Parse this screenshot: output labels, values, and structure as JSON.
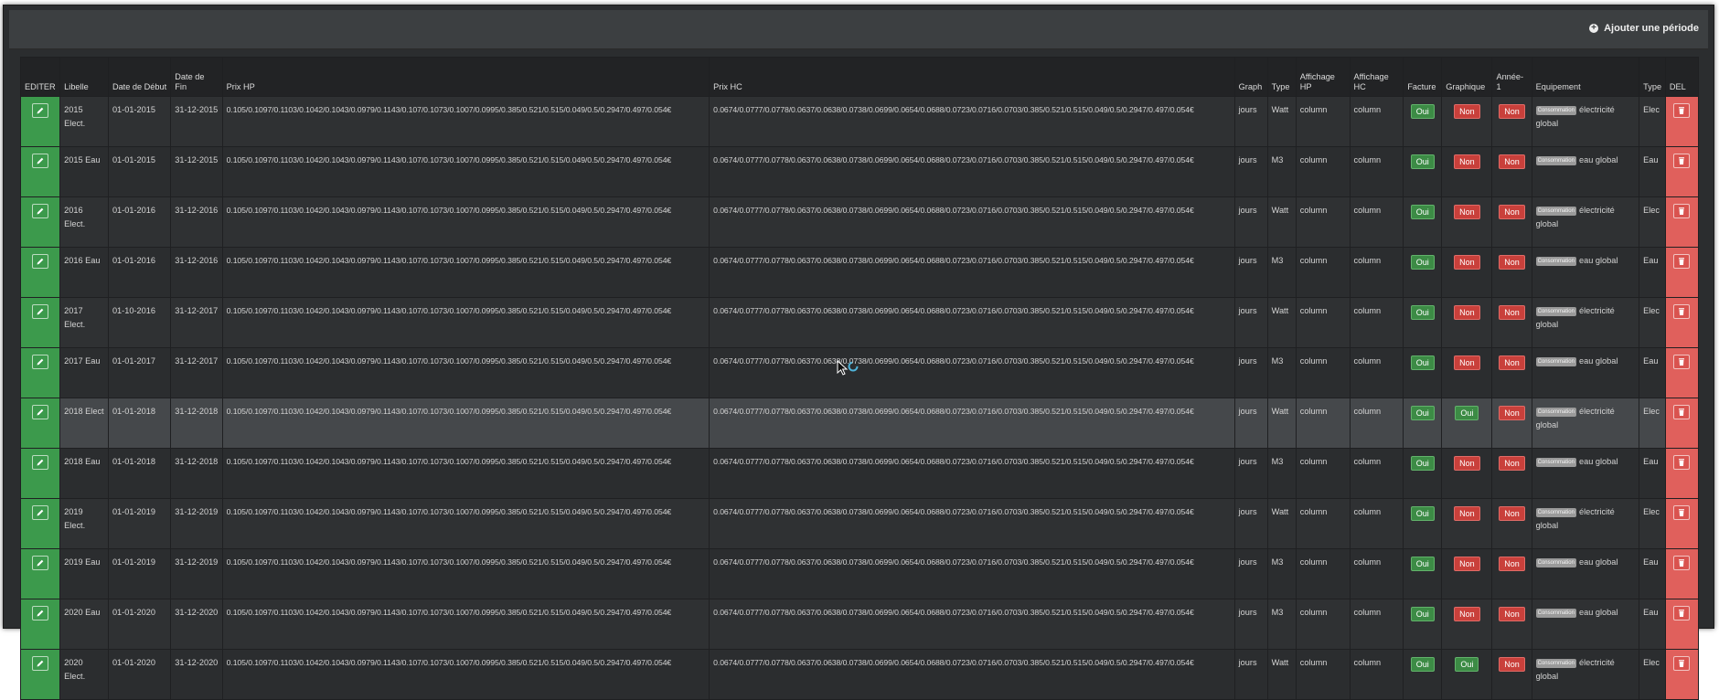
{
  "toolbar": {
    "add_label": "Ajouter une période"
  },
  "columns": {
    "editer": "EDITER",
    "libelle": "Libelle",
    "date_debut": "Date de Début",
    "date_fin": "Date de Fin",
    "prix_hp": "Prix HP",
    "prix_hc": "Prix HC",
    "graph": "Graph",
    "type": "Type",
    "affichage_hp": "Affichage HP",
    "affichage_hc": "Affichage HC",
    "facture": "Facture",
    "graphique": "Graphique",
    "annee": "Année-1",
    "equipement": "Equipement",
    "type2": "Type",
    "del": "DEL"
  },
  "equipment_badge": "Consommation",
  "colors": {
    "edit": "#3c9a4c",
    "delete": "#e0605c",
    "oui": "#3c8b45",
    "non": "#c9403b"
  },
  "rows": [
    {
      "libelle": "2015 Elect.",
      "debut": "01-01-2015",
      "fin": "31-12-2015",
      "prix_hp": "0.105/0.1097/0.1103/0.1042/0.1043/0.0979/0.1143/0.107/0.1073/0.1007/0.0995/0.385/0.521/0.515/0.049/0.5/0.2947/0.497/0.054€",
      "prix_hc": "0.0674/0.0777/0.0778/0.0637/0.0638/0.0738/0.0699/0.0654/0.0688/0.0723/0.0716/0.0703/0.385/0.521/0.515/0.049/0.5/0.2947/0.497/0.054€",
      "graph": "jours",
      "type": "Watt",
      "aff_hp": "column",
      "aff_hc": "column",
      "facture": "Oui",
      "graphique": "Non",
      "annee": "Non",
      "equipement": "électricité global",
      "type2": "Elec"
    },
    {
      "libelle": "2015 Eau",
      "debut": "01-01-2015",
      "fin": "31-12-2015",
      "prix_hp": "0.105/0.1097/0.1103/0.1042/0.1043/0.0979/0.1143/0.107/0.1073/0.1007/0.0995/0.385/0.521/0.515/0.049/0.5/0.2947/0.497/0.054€",
      "prix_hc": "0.0674/0.0777/0.0778/0.0637/0.0638/0.0738/0.0699/0.0654/0.0688/0.0723/0.0716/0.0703/0.385/0.521/0.515/0.049/0.5/0.2947/0.497/0.054€",
      "graph": "jours",
      "type": "M3",
      "aff_hp": "column",
      "aff_hc": "column",
      "facture": "Oui",
      "graphique": "Non",
      "annee": "Non",
      "equipement": "eau global",
      "type2": "Eau"
    },
    {
      "libelle": "2016 Elect.",
      "debut": "01-01-2016",
      "fin": "31-12-2016",
      "prix_hp": "0.105/0.1097/0.1103/0.1042/0.1043/0.0979/0.1143/0.107/0.1073/0.1007/0.0995/0.385/0.521/0.515/0.049/0.5/0.2947/0.497/0.054€",
      "prix_hc": "0.0674/0.0777/0.0778/0.0637/0.0638/0.0738/0.0699/0.0654/0.0688/0.0723/0.0716/0.0703/0.385/0.521/0.515/0.049/0.5/0.2947/0.497/0.054€",
      "graph": "jours",
      "type": "Watt",
      "aff_hp": "column",
      "aff_hc": "column",
      "facture": "Oui",
      "graphique": "Non",
      "annee": "Non",
      "equipement": "électricité global",
      "type2": "Elec"
    },
    {
      "libelle": "2016 Eau",
      "debut": "01-01-2016",
      "fin": "31-12-2016",
      "prix_hp": "0.105/0.1097/0.1103/0.1042/0.1043/0.0979/0.1143/0.107/0.1073/0.1007/0.0995/0.385/0.521/0.515/0.049/0.5/0.2947/0.497/0.054€",
      "prix_hc": "0.0674/0.0777/0.0778/0.0637/0.0638/0.0738/0.0699/0.0654/0.0688/0.0723/0.0716/0.0703/0.385/0.521/0.515/0.049/0.5/0.2947/0.497/0.054€",
      "graph": "jours",
      "type": "M3",
      "aff_hp": "column",
      "aff_hc": "column",
      "facture": "Oui",
      "graphique": "Non",
      "annee": "Non",
      "equipement": "eau global",
      "type2": "Eau"
    },
    {
      "libelle": "2017 Elect.",
      "debut": "01-10-2016",
      "fin": "31-12-2017",
      "prix_hp": "0.105/0.1097/0.1103/0.1042/0.1043/0.0979/0.1143/0.107/0.1073/0.1007/0.0995/0.385/0.521/0.515/0.049/0.5/0.2947/0.497/0.054€",
      "prix_hc": "0.0674/0.0777/0.0778/0.0637/0.0638/0.0738/0.0699/0.0654/0.0688/0.0723/0.0716/0.0703/0.385/0.521/0.515/0.049/0.5/0.2947/0.497/0.054€",
      "graph": "jours",
      "type": "Watt",
      "aff_hp": "column",
      "aff_hc": "column",
      "facture": "Oui",
      "graphique": "Non",
      "annee": "Non",
      "equipement": "électricité global",
      "type2": "Elec"
    },
    {
      "libelle": "2017 Eau",
      "debut": "01-01-2017",
      "fin": "31-12-2017",
      "prix_hp": "0.105/0.1097/0.1103/0.1042/0.1043/0.0979/0.1143/0.107/0.1073/0.1007/0.0995/0.385/0.521/0.515/0.049/0.5/0.2947/0.497/0.054€",
      "prix_hc": "0.0674/0.0777/0.0778/0.0637/0.0638/0.0738/0.0699/0.0654/0.0688/0.0723/0.0716/0.0703/0.385/0.521/0.515/0.049/0.5/0.2947/0.497/0.054€",
      "graph": "jours",
      "type": "M3",
      "aff_hp": "column",
      "aff_hc": "column",
      "facture": "Oui",
      "graphique": "Non",
      "annee": "Non",
      "equipement": "eau global",
      "type2": "Eau"
    },
    {
      "libelle": "2018 Elect",
      "debut": "01-01-2018",
      "fin": "31-12-2018",
      "prix_hp": "0.105/0.1097/0.1103/0.1042/0.1043/0.0979/0.1143/0.107/0.1073/0.1007/0.0995/0.385/0.521/0.515/0.049/0.5/0.2947/0.497/0.054€",
      "prix_hc": "0.0674/0.0777/0.0778/0.0637/0.0638/0.0738/0.0699/0.0654/0.0688/0.0723/0.0716/0.0703/0.385/0.521/0.515/0.049/0.5/0.2947/0.497/0.054€",
      "graph": "jours",
      "type": "Watt",
      "aff_hp": "column",
      "aff_hc": "column",
      "facture": "Oui",
      "graphique": "Oui",
      "annee": "Non",
      "equipement": "électricité global",
      "type2": "Elec"
    },
    {
      "libelle": "2018 Eau",
      "debut": "01-01-2018",
      "fin": "31-12-2018",
      "prix_hp": "0.105/0.1097/0.1103/0.1042/0.1043/0.0979/0.1143/0.107/0.1073/0.1007/0.0995/0.385/0.521/0.515/0.049/0.5/0.2947/0.497/0.054€",
      "prix_hc": "0.0674/0.0777/0.0778/0.0637/0.0638/0.0738/0.0699/0.0654/0.0688/0.0723/0.0716/0.0703/0.385/0.521/0.515/0.049/0.5/0.2947/0.497/0.054€",
      "graph": "jours",
      "type": "M3",
      "aff_hp": "column",
      "aff_hc": "column",
      "facture": "Oui",
      "graphique": "Non",
      "annee": "Non",
      "equipement": "eau global",
      "type2": "Eau"
    },
    {
      "libelle": "2019 Elect.",
      "debut": "01-01-2019",
      "fin": "31-12-2019",
      "prix_hp": "0.105/0.1097/0.1103/0.1042/0.1043/0.0979/0.1143/0.107/0.1073/0.1007/0.0995/0.385/0.521/0.515/0.049/0.5/0.2947/0.497/0.054€",
      "prix_hc": "0.0674/0.0777/0.0778/0.0637/0.0638/0.0738/0.0699/0.0654/0.0688/0.0723/0.0716/0.0703/0.385/0.521/0.515/0.049/0.5/0.2947/0.497/0.054€",
      "graph": "jours",
      "type": "Watt",
      "aff_hp": "column",
      "aff_hc": "column",
      "facture": "Oui",
      "graphique": "Non",
      "annee": "Non",
      "equipement": "électricité global",
      "type2": "Elec"
    },
    {
      "libelle": "2019 Eau",
      "debut": "01-01-2019",
      "fin": "31-12-2019",
      "prix_hp": "0.105/0.1097/0.1103/0.1042/0.1043/0.0979/0.1143/0.107/0.1073/0.1007/0.0995/0.385/0.521/0.515/0.049/0.5/0.2947/0.497/0.054€",
      "prix_hc": "0.0674/0.0777/0.0778/0.0637/0.0638/0.0738/0.0699/0.0654/0.0688/0.0723/0.0716/0.0703/0.385/0.521/0.515/0.049/0.5/0.2947/0.497/0.054€",
      "graph": "jours",
      "type": "M3",
      "aff_hp": "column",
      "aff_hc": "column",
      "facture": "Oui",
      "graphique": "Non",
      "annee": "Non",
      "equipement": "eau global",
      "type2": "Eau"
    },
    {
      "libelle": "2020 Eau",
      "debut": "01-01-2020",
      "fin": "31-12-2020",
      "prix_hp": "0.105/0.1097/0.1103/0.1042/0.1043/0.0979/0.1143/0.107/0.1073/0.1007/0.0995/0.385/0.521/0.515/0.049/0.5/0.2947/0.497/0.054€",
      "prix_hc": "0.0674/0.0777/0.0778/0.0637/0.0638/0.0738/0.0699/0.0654/0.0688/0.0723/0.0716/0.0703/0.385/0.521/0.515/0.049/0.5/0.2947/0.497/0.054€",
      "graph": "jours",
      "type": "M3",
      "aff_hp": "column",
      "aff_hc": "column",
      "facture": "Oui",
      "graphique": "Non",
      "annee": "Non",
      "equipement": "eau global",
      "type2": "Eau"
    },
    {
      "libelle": "2020 Elect.",
      "debut": "01-01-2020",
      "fin": "31-12-2020",
      "prix_hp": "0.105/0.1097/0.1103/0.1042/0.1043/0.0979/0.1143/0.107/0.1073/0.1007/0.0995/0.385/0.521/0.515/0.049/0.5/0.2947/0.497/0.054€",
      "prix_hc": "0.0674/0.0777/0.0778/0.0637/0.0638/0.0738/0.0699/0.0654/0.0688/0.0723/0.0716/0.0703/0.385/0.521/0.515/0.049/0.5/0.2947/0.497/0.054€",
      "graph": "jours",
      "type": "Watt",
      "aff_hp": "column",
      "aff_hc": "column",
      "facture": "Oui",
      "graphique": "Oui",
      "annee": "Non",
      "equipement": "électricité global",
      "type2": "Elec"
    }
  ]
}
